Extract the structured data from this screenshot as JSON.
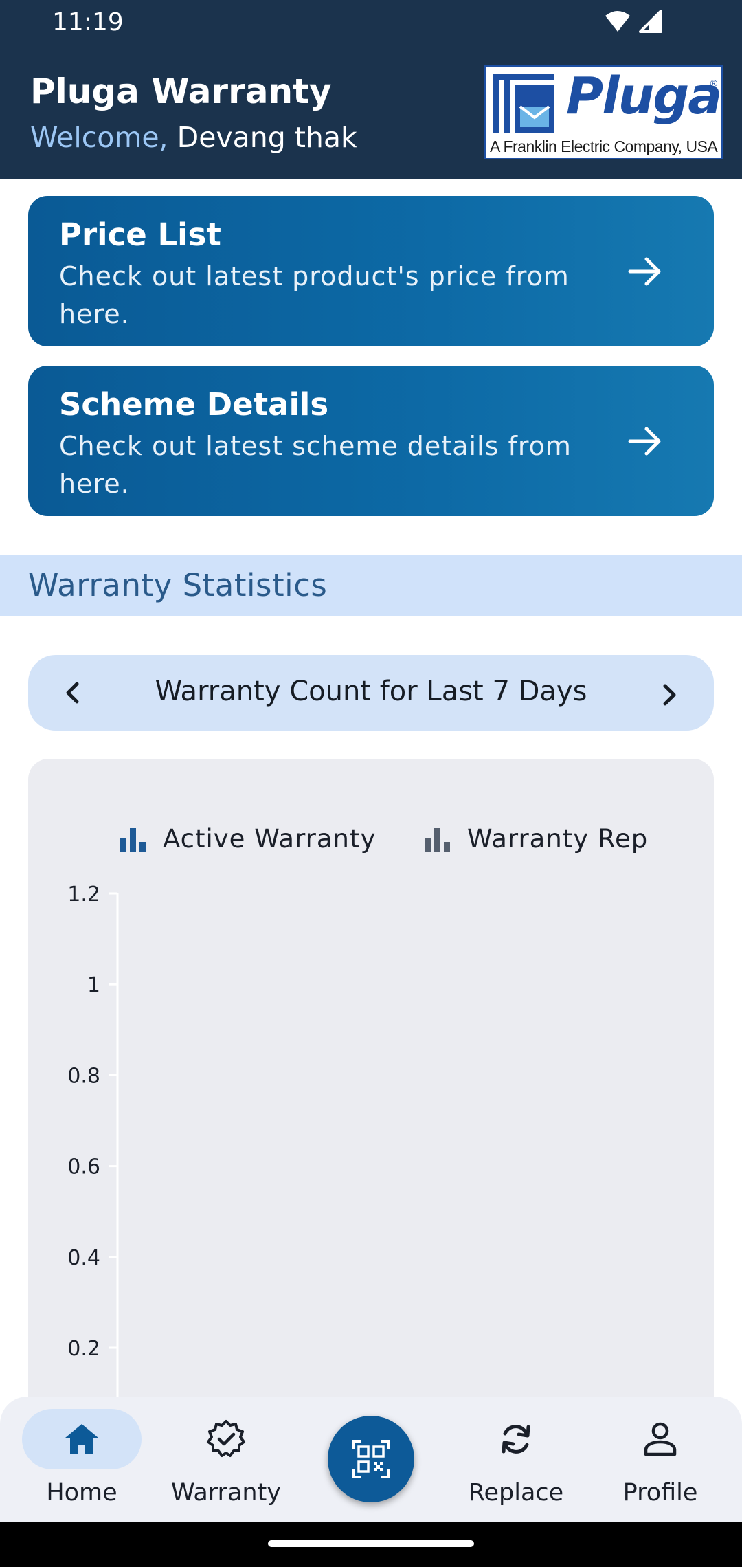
{
  "status_bar": {
    "time": "11:19"
  },
  "header": {
    "title": "Pluga Warranty",
    "welcome_label": "Welcome,",
    "user_name": "Devang thak",
    "logo": {
      "name": "Pluga",
      "tagline": "A Franklin Electric Company, USA"
    }
  },
  "cards": [
    {
      "title": "Price List",
      "description": "Check out latest product's price from here."
    },
    {
      "title": "Scheme Details",
      "description": "Check out latest scheme details from here."
    }
  ],
  "stats": {
    "section_title": "Warranty Statistics",
    "period_label": "Warranty Count for Last 7 Days"
  },
  "chart_data": {
    "type": "bar",
    "series": [
      {
        "name": "Active Warranty",
        "color": "#1e5a96",
        "values": []
      },
      {
        "name": "Warranty Rep",
        "color": "#555f6e",
        "values": []
      }
    ],
    "yticks": [
      "1.2",
      "1",
      "0.8",
      "0.6",
      "0.4",
      "0.2"
    ],
    "ylim": [
      0,
      1.2
    ],
    "legend_position": "top"
  },
  "bottom_nav": {
    "items": [
      {
        "label": "Home",
        "icon": "home-icon",
        "active": true
      },
      {
        "label": "Warranty",
        "icon": "verified-badge-icon",
        "active": false
      },
      {
        "label": "Replace",
        "icon": "refresh-icon",
        "active": false
      },
      {
        "label": "Profile",
        "icon": "person-icon",
        "active": false
      }
    ],
    "scan_icon": "qr-scan-icon"
  },
  "colors": {
    "header_bg": "#1b334d",
    "card_blue": "#0d6aa6",
    "band_bg": "#d0e2fa",
    "fab_bg": "#0d5a98"
  }
}
